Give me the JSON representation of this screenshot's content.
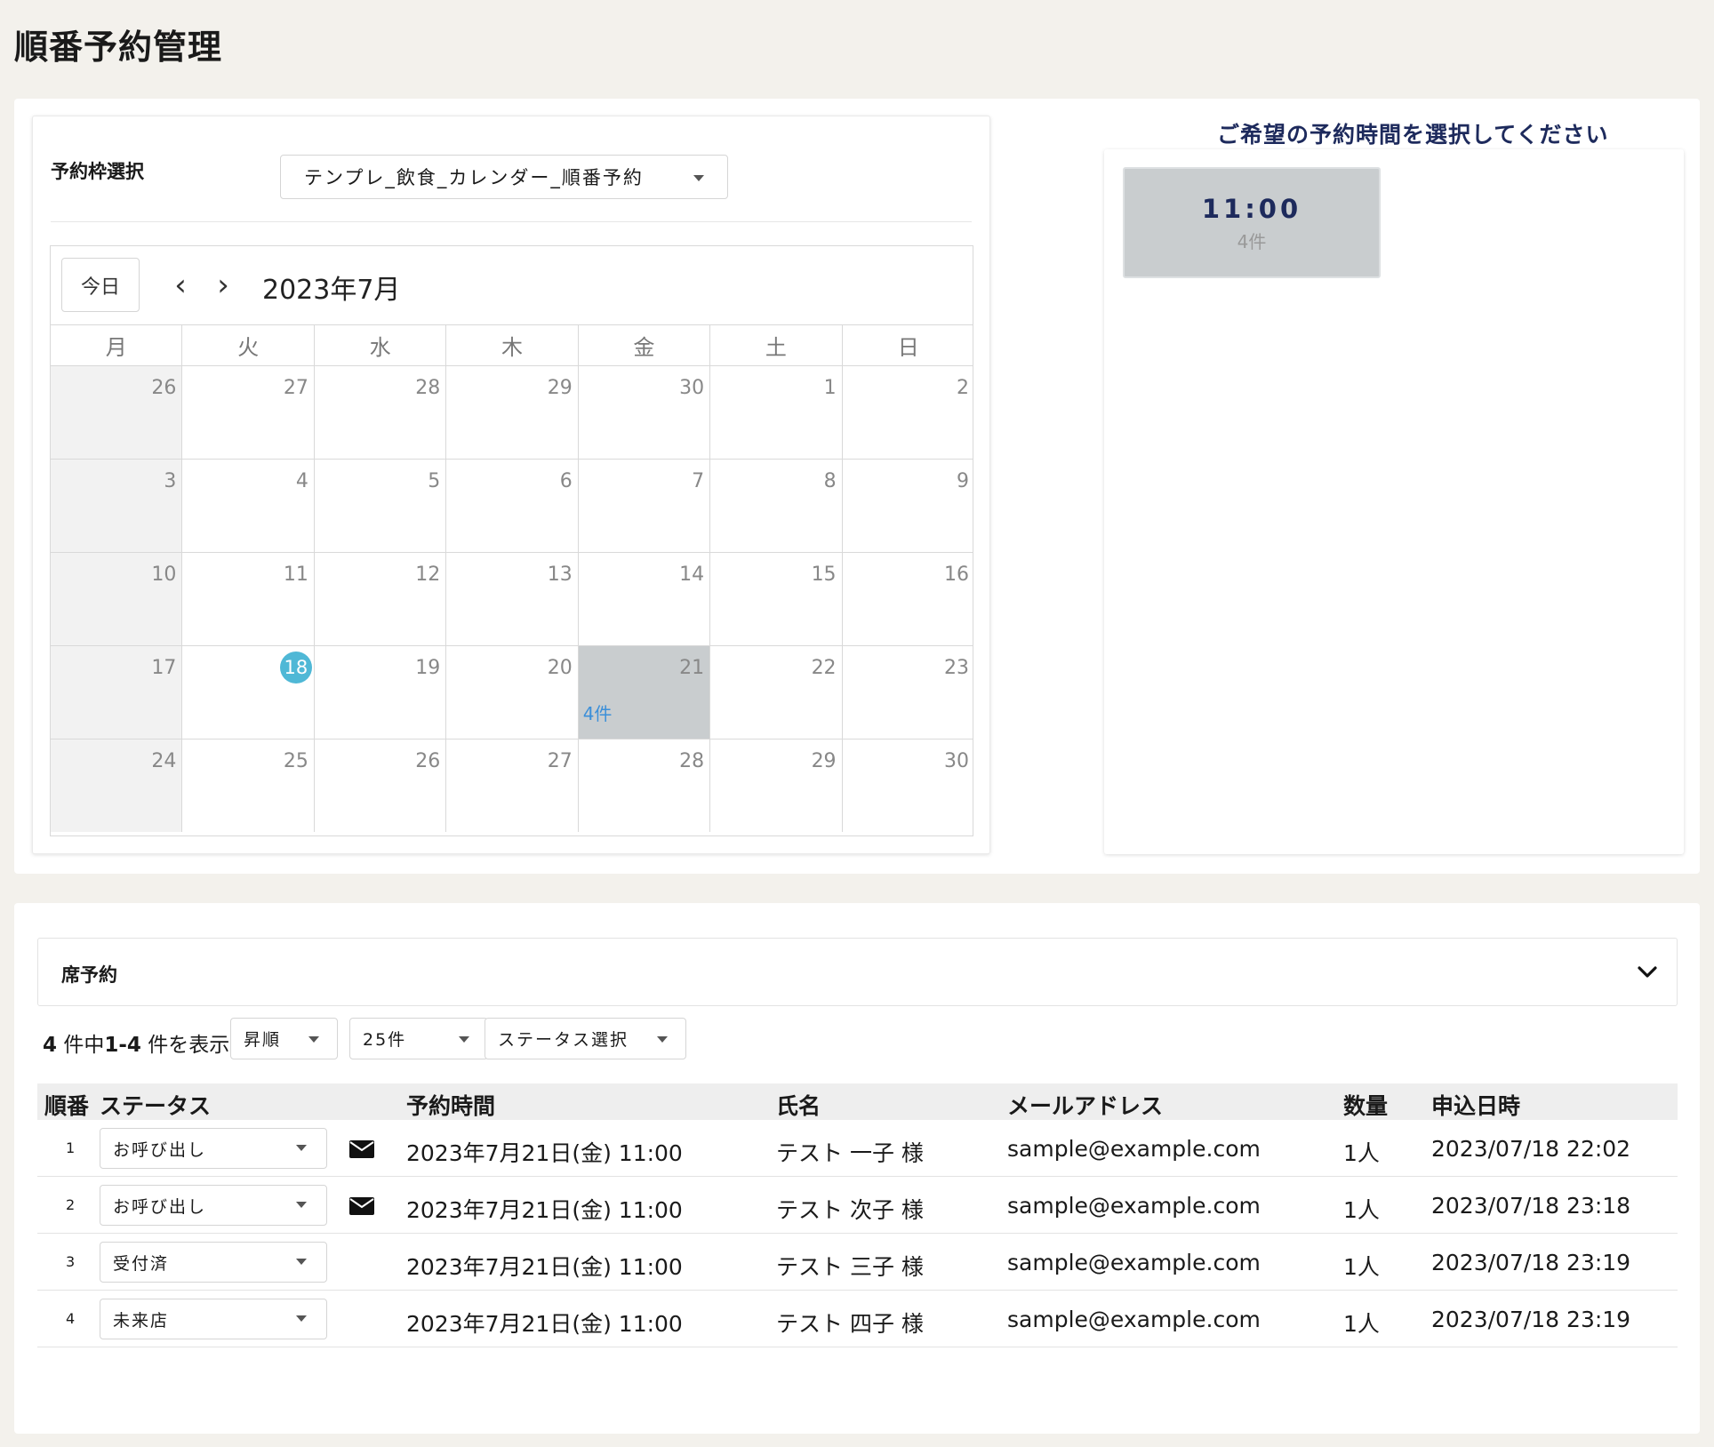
{
  "page": {
    "title": "順番予約管理"
  },
  "reservation_frame": {
    "label": "予約枠選択",
    "selected": "テンプレ_飲食_カレンダー_順番予約"
  },
  "calendar": {
    "today_label": "今日",
    "prev_icon": "‹",
    "next_icon": "›",
    "month_title": "2023年7月",
    "weekdays": [
      "月",
      "火",
      "水",
      "木",
      "金",
      "土",
      "日"
    ],
    "days": [
      "26",
      "27",
      "28",
      "29",
      "30",
      "1",
      "2",
      "3",
      "4",
      "5",
      "6",
      "7",
      "8",
      "9",
      "10",
      "11",
      "12",
      "13",
      "14",
      "15",
      "16",
      "17",
      "18",
      "19",
      "20",
      "21",
      "22",
      "23",
      "24",
      "25",
      "26",
      "27",
      "28",
      "29",
      "30"
    ],
    "today_day": "18",
    "selected_day": "21",
    "selected_count": "4件"
  },
  "time_slots": {
    "heading": "ご希望の予約時間を選択してください",
    "slots": [
      {
        "time": "11:00",
        "count": "4件"
      }
    ]
  },
  "section": {
    "title": "席予約"
  },
  "list": {
    "count_total": "4",
    "count_mid": " 件中",
    "count_range": "1-4",
    "count_suffix": " 件を表示",
    "order": "昇順",
    "page_size": "25件",
    "status_filter": "ステータス選択"
  },
  "table": {
    "headers": {
      "no": "順番",
      "status": "ステータス",
      "time": "予約時間",
      "name": "氏名",
      "email": "メールアドレス",
      "qty": "数量",
      "applied": "申込日時"
    },
    "rows": [
      {
        "no": "1",
        "status": "お呼び出し",
        "mail": true,
        "time": "2023年7月21日(金) 11:00",
        "name": "テスト 一子 様",
        "email": "sample@example.com",
        "qty": "1人",
        "applied": "2023/07/18 22:02"
      },
      {
        "no": "2",
        "status": "お呼び出し",
        "mail": true,
        "time": "2023年7月21日(金) 11:00",
        "name": "テスト 次子 様",
        "email": "sample@example.com",
        "qty": "1人",
        "applied": "2023/07/18 23:18"
      },
      {
        "no": "3",
        "status": "受付済",
        "mail": false,
        "time": "2023年7月21日(金) 11:00",
        "name": "テスト 三子 様",
        "email": "sample@example.com",
        "qty": "1人",
        "applied": "2023/07/18 23:19"
      },
      {
        "no": "4",
        "status": "未来店",
        "mail": false,
        "time": "2023年7月21日(金) 11:00",
        "name": "テスト 四子 様",
        "email": "sample@example.com",
        "qty": "1人",
        "applied": "2023/07/18 23:19"
      }
    ]
  },
  "colors": {
    "background": "#f3f1ec",
    "accent_navy": "#1d2a5c",
    "today_circle": "#4fb8d6",
    "count_link": "#3b8fd9",
    "selected_cell": "#c9cdcf"
  }
}
